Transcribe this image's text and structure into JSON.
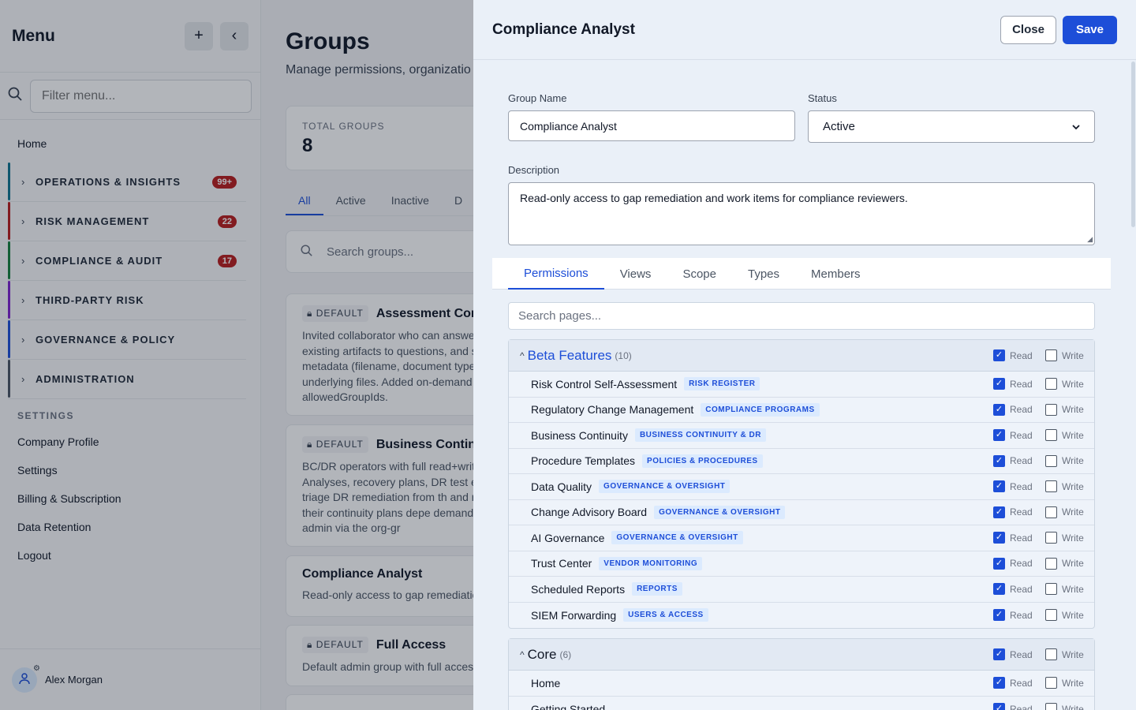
{
  "sidebar": {
    "title": "Menu",
    "add_icon": "plus-icon",
    "collapse_icon": "chevron-left-icon",
    "filter_placeholder": "Filter menu...",
    "home": "Home",
    "sections": [
      {
        "label": "OPERATIONS & INSIGHTS",
        "badge": "99+",
        "color": "#0e7490"
      },
      {
        "label": "RISK MANAGEMENT",
        "badge": "22",
        "color": "#b91c1c"
      },
      {
        "label": "COMPLIANCE & AUDIT",
        "badge": "17",
        "color": "#15803d"
      },
      {
        "label": "THIRD-PARTY RISK",
        "badge": "",
        "color": "#7e22ce"
      },
      {
        "label": "GOVERNANCE & POLICY",
        "badge": "",
        "color": "#1d4ed8"
      },
      {
        "label": "ADMINISTRATION",
        "badge": "",
        "color": "#4b5563"
      }
    ],
    "settings_heading": "SETTINGS",
    "settings_links": [
      "Company Profile",
      "Settings",
      "Billing & Subscription",
      "Data Retention",
      "Logout"
    ],
    "user_name": "Alex Morgan"
  },
  "groups_page": {
    "title": "Groups",
    "subtitle": "Manage permissions, organizatio",
    "stat_label": "TOTAL GROUPS",
    "stat_value": "8",
    "tabs": [
      "All",
      "Active",
      "Inactive",
      "D"
    ],
    "search_placeholder": "Search groups...",
    "cards": [
      {
        "default": "DEFAULT",
        "name": "Assessment Cont",
        "desc": "Invited collaborator who can answe existing artifacts to questions, and s metadata (filename, document type underlying files. Added on-demand allowedGroupIds."
      },
      {
        "default": "DEFAULT",
        "name": "Business Continu",
        "desc": "BC/DR operators with full read+writ Analyses, recovery plans, DR test e They triage DR remediation from th and risks their continuity plans depe demand by an admin via the org-gr"
      },
      {
        "default": "",
        "name": "Compliance Analyst",
        "desc": "Read-only access to gap remediatio"
      },
      {
        "default": "DEFAULT",
        "name": "Full Access",
        "desc": "Default admin group with full acces"
      }
    ]
  },
  "drawer": {
    "title": "Compliance Analyst",
    "close_label": "Close",
    "save_label": "Save",
    "group_name_label": "Group Name",
    "group_name_value": "Compliance Analyst",
    "status_label": "Status",
    "status_value": "Active",
    "description_label": "Description",
    "description_value": "Read-only access to gap remediation and work items for compliance reviewers.",
    "tabs": [
      "Permissions",
      "Views",
      "Scope",
      "Types",
      "Members"
    ],
    "page_search_placeholder": "Search pages...",
    "read_label": "Read",
    "write_label": "Write",
    "accent_color": "#1d4ed8",
    "panels": [
      {
        "name": "Beta Features",
        "count": "(10)",
        "read": true,
        "write": false,
        "rows": [
          {
            "name": "Risk Control Self-Assessment",
            "tag": "RISK REGISTER",
            "read": true,
            "write": false
          },
          {
            "name": "Regulatory Change Management",
            "tag": "COMPLIANCE PROGRAMS",
            "read": true,
            "write": false
          },
          {
            "name": "Business Continuity",
            "tag": "BUSINESS CONTINUITY & DR",
            "read": true,
            "write": false
          },
          {
            "name": "Procedure Templates",
            "tag": "POLICIES & PROCEDURES",
            "read": true,
            "write": false
          },
          {
            "name": "Data Quality",
            "tag": "GOVERNANCE & OVERSIGHT",
            "read": true,
            "write": false
          },
          {
            "name": "Change Advisory Board",
            "tag": "GOVERNANCE & OVERSIGHT",
            "read": true,
            "write": false
          },
          {
            "name": "AI Governance",
            "tag": "GOVERNANCE & OVERSIGHT",
            "read": true,
            "write": false
          },
          {
            "name": "Trust Center",
            "tag": "VENDOR MONITORING",
            "read": true,
            "write": false
          },
          {
            "name": "Scheduled Reports",
            "tag": "REPORTS",
            "read": true,
            "write": false
          },
          {
            "name": "SIEM Forwarding",
            "tag": "USERS & ACCESS",
            "read": true,
            "write": false
          }
        ]
      },
      {
        "name": "Core",
        "count": "(6)",
        "read": true,
        "write": false,
        "rows": [
          {
            "name": "Home",
            "tag": "",
            "read": true,
            "write": false
          },
          {
            "name": "Getting Started",
            "tag": "",
            "read": true,
            "write": false
          }
        ]
      }
    ]
  }
}
